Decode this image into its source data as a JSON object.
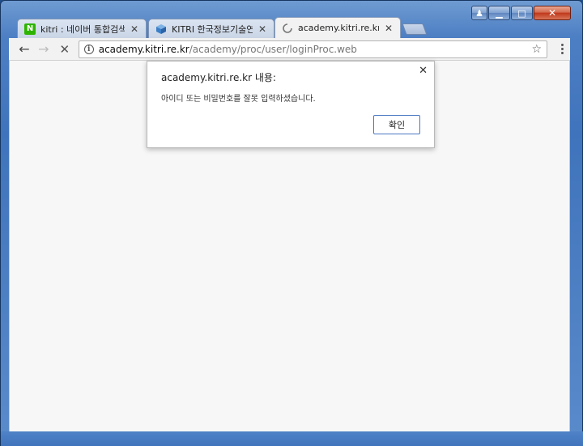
{
  "window": {
    "controls": {
      "user": "♟",
      "minimize": "▁",
      "maximize": "□",
      "close": "✕"
    }
  },
  "tabs": [
    {
      "label": "kitri : 네이버 통합검색",
      "icon": "naver-n-icon",
      "icon_glyph": "N",
      "close": "✕",
      "active": false
    },
    {
      "label": "KITRI 한국정보기술연구원",
      "icon": "cube-icon",
      "close": "✕",
      "active": false
    },
    {
      "label": "academy.kitri.re.kr/academy",
      "icon": "loading-spinner-icon",
      "close": "✕",
      "active": true
    }
  ],
  "toolbar": {
    "back_glyph": "←",
    "forward_glyph": "→",
    "stop_glyph": "✕",
    "info_glyph": "i",
    "url_host": "academy.kitri.re.kr",
    "url_path": "/academy/proc/user/loginProc.web",
    "star_glyph": "☆"
  },
  "dialog": {
    "title": "academy.kitri.re.kr 내용:",
    "message": "아이디 또는 비밀번호를 잘못 입력하셨습니다.",
    "ok_label": "확인",
    "close_glyph": "✕"
  },
  "colors": {
    "frame": "#3f73bb",
    "naver": "#2db400",
    "ok_border": "#4a78c2"
  }
}
